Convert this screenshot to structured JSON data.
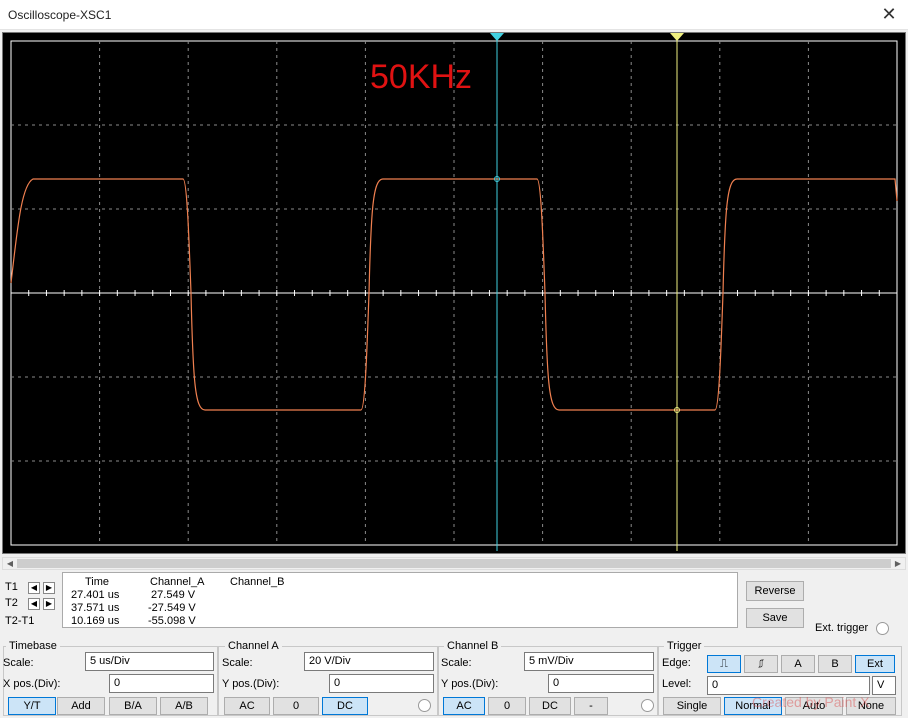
{
  "window": {
    "title": "Oscilloscope-XSC1",
    "close_glyph": "✕"
  },
  "screen": {
    "annotation": "50KHz",
    "colors": {
      "background": "#000000",
      "grid": "#8a8a8a",
      "axis": "#ffffff",
      "trace_a": "#f08050",
      "cursor_t1": "#40d0e0",
      "cursor_t2": "#f0f080"
    }
  },
  "scroll": {
    "left_icon": "arrow-left-icon",
    "right_icon": "arrow-right-icon"
  },
  "cursors": {
    "t1_label": "T1",
    "t2_label": "T2",
    "diff_label": "T2-T1"
  },
  "readout": {
    "headers": [
      "Time",
      "Channel_A",
      "Channel_B"
    ],
    "rows": [
      {
        "time": "27.401 us",
        "a": " 27.549 V",
        "b": ""
      },
      {
        "time": "37.571 us",
        "a": "-27.549 V",
        "b": ""
      },
      {
        "time": "10.169 us",
        "a": "-55.098 V",
        "b": ""
      }
    ]
  },
  "actions": {
    "reverse": "Reverse",
    "save": "Save",
    "ext_trigger": "Ext. trigger"
  },
  "timebase": {
    "title": "Timebase",
    "scale_label": "Scale:",
    "scale_value": "5 us/Div",
    "xpos_label": "X pos.(Div):",
    "xpos_value": "0",
    "modes": [
      "Y/T",
      "Add",
      "B/A",
      "A/B"
    ],
    "active_mode": 0
  },
  "channel_a": {
    "title": "Channel A",
    "scale_label": "Scale:",
    "scale_value": "20  V/Div",
    "ypos_label": "Y pos.(Div):",
    "ypos_value": "0",
    "couplings": [
      "AC",
      "0",
      "DC"
    ],
    "active_coupling": 2
  },
  "channel_b": {
    "title": "Channel B",
    "scale_label": "Scale:",
    "scale_value": "5 mV/Div",
    "ypos_label": "Y pos.(Div):",
    "ypos_value": "0",
    "couplings": [
      "AC",
      "0",
      "DC",
      "-"
    ],
    "active_coupling": 0
  },
  "trigger": {
    "title": "Trigger",
    "edge_label": "Edge:",
    "level_label": "Level:",
    "level_value": "0",
    "level_unit": "V",
    "edge_buttons": [
      "⎍",
      "⎎",
      "A",
      "B",
      "Ext"
    ],
    "modes": [
      "Single",
      "Normal",
      "Auto",
      "None"
    ],
    "active_mode": 1
  },
  "watermark": "Created by Paint X"
}
